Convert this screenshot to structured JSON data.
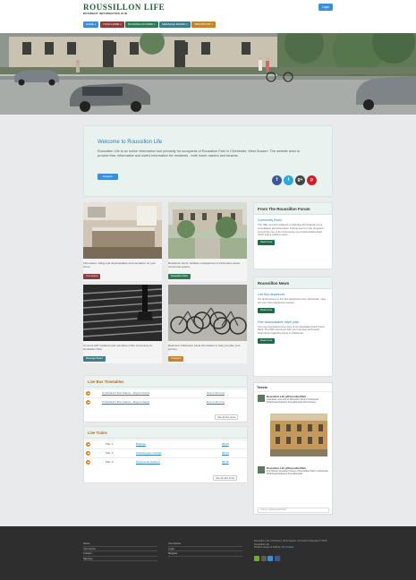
{
  "header": {
    "brand_title": "ROUSSILLON LIFE",
    "brand_subtitle": "RESIDENT INFORMATION HUB",
    "login_label": "Login"
  },
  "nav": [
    {
      "label": "HOME",
      "color": "#3a8fd6"
    },
    {
      "label": "YOUR HOME",
      "color": "#8e3b3b"
    },
    {
      "label": "ROUSSILLON PARK",
      "color": "#2e7a55"
    },
    {
      "label": "MESSAGE BOARD",
      "color": "#3c7d8c"
    },
    {
      "label": "TRANSPORT",
      "color": "#c8822a"
    }
  ],
  "welcome": {
    "title": "Welcome to Roussillon Life",
    "body": "Roussillon Life is an online information hub primarily for occupants of Roussillon Park in Chichester, West Sussex. The website aims to provide free, informative and useful information for residents - both home owners and tenants.",
    "register_label": "Register"
  },
  "social": [
    {
      "icon": "facebook-icon",
      "glyph": "f",
      "color": "#3b5998"
    },
    {
      "icon": "twitter-icon",
      "glyph": "t",
      "color": "#2fa7e0"
    },
    {
      "icon": "google-plus-icon",
      "glyph": "g+",
      "color": "#444444"
    },
    {
      "icon": "pinterest-icon",
      "glyph": "p",
      "color": "#cb2027"
    }
  ],
  "cards": [
    {
      "text": "Information, billing and downloadable documentation for your home.",
      "button": "Your Home",
      "color": "#8e3b3b"
    },
    {
      "text": "Residents' forum, facilities management & information about communal spaces.",
      "button": "Roussillon Park",
      "color": "#2e7a55"
    },
    {
      "text": "Connect with residents and members of the community at Roussillon Park.",
      "button": "Message Board",
      "color": "#3c7d8c"
    },
    {
      "text": "Real-time Chichester travel information to help you plan your journey.",
      "button": "Transport",
      "color": "#c8822a"
    }
  ],
  "bus": {
    "title": "Live Bus Timetables",
    "rows": [
      {
        "route": "St Richard's Bus Station - Bognor Regis",
        "due": "Due in 09 mins"
      },
      {
        "route": "St Richard's Bus Station - Bognor Regis",
        "due": "Due in 29 mins"
      }
    ],
    "more": "See all bus times"
  },
  "trains": {
    "title": "Live Trains",
    "rows": [
      {
        "plat": "Plat. 1",
        "dest": "Brighton",
        "time": "08:28"
      },
      {
        "plat": "Plat. 2",
        "dest": "Southampton Central",
        "time": "08:33"
      },
      {
        "plat": "Plat. 2",
        "dest": "Portsmouth Harbour",
        "time": "08:35"
      }
    ],
    "more": "See all train times"
  },
  "forum": {
    "title": "From The Roussillon Forum",
    "item_title": "Community Room",
    "item_text": "The CEF met with residents on Monday 4th February for a consultation and information sharing event on the proposed community use of the Community room at Roussillon Park which was a positive event...",
    "button": "Read more"
  },
  "news": {
    "title": "Roussillon News",
    "items": [
      {
        "title": "Live Bus departures",
        "text": "For quick access to live bus departures from Chichester, view the Live Train Departures section.",
        "button": "Read more"
      },
      {
        "title": "Free downloadable travel pack",
        "text": "You may download a free copy of our Roussillon Park Travel Pack. The PDF document lists you important and useful information regarding travel in Chichester.",
        "button": "Read more"
      }
    ]
  },
  "twitter": {
    "title": "Tweets",
    "items": [
      {
        "name": "Roussillon Life @RoussillonPark",
        "text": "A fantastic new shot of Roussillon Park in Chichester #ChichesterGardens #roussillonpark #westsussex"
      },
      {
        "name": "Roussillon Life @RoussillonPark",
        "text": "The Historic Frontline Houses of Roussillon Park in Chichester #ChichesterGardens #roussillonpark"
      }
    ],
    "input_placeholder": "Tweet to @RoussillonPark"
  },
  "footer": {
    "col1": [
      "Home",
      "Your Home",
      "Contact",
      "Sitemap"
    ],
    "col2": [
      "Your Home",
      "Login",
      "Register"
    ],
    "copyright": "Roussillon Life, Chichester, West Sussex. All content Copyright © 2013 Roussillon Life.",
    "designed": "Website design & build by",
    "designer": "Tel Creative"
  }
}
